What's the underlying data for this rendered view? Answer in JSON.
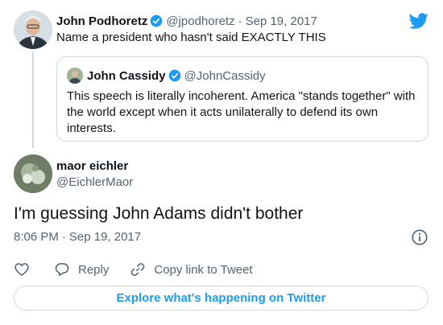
{
  "colors": {
    "accent": "#1d9bf0",
    "text_primary": "#0f1419",
    "text_secondary": "#536471",
    "border": "#cfd9de"
  },
  "icons": {
    "brand": "twitter-bird-icon",
    "verified": "verified-badge-icon",
    "info": "info-icon",
    "like": "heart-icon",
    "reply": "speech-bubble-icon",
    "copy": "link-icon"
  },
  "parent_tweet": {
    "author_name": "John Podhoretz",
    "author_handle": "@jpodhoretz",
    "separator": "·",
    "date": "Sep 19, 2017",
    "text": "Name a president who hasn't said EXACTLY THIS"
  },
  "quoted_tweet": {
    "author_name": "John Cassidy",
    "author_handle": "@JohnCassidy",
    "text": "This speech is literally incoherent. America \"stands together\" with the world except when it acts unilaterally to defend its own interests."
  },
  "reply_tweet": {
    "author_name": "maor eichler",
    "author_handle": "@EichlerMaor",
    "text": "I'm guessing John Adams didn't bother",
    "time": "8:06 PM",
    "separator": "·",
    "date": "Sep 19, 2017"
  },
  "actions": {
    "reply_label": "Reply",
    "copy_label": "Copy link to Tweet"
  },
  "explore_label": "Explore what's happening on Twitter"
}
